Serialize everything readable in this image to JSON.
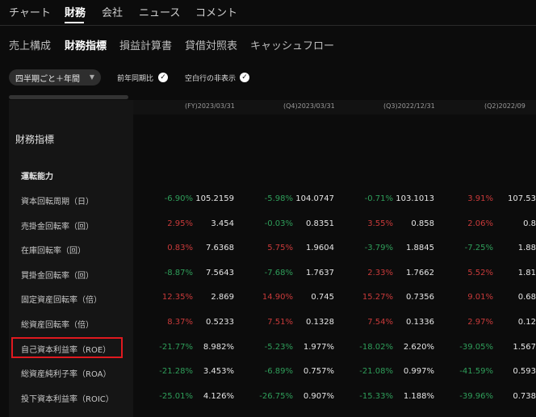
{
  "top_nav": [
    "チャート",
    "財務",
    "会社",
    "ニュース",
    "コメント"
  ],
  "sub_nav": [
    "売上構成",
    "財務指標",
    "損益計算書",
    "貸借対照表",
    "キャッシュフロー"
  ],
  "controls": {
    "period_select": "四半期ごと＋年間",
    "toggle_yoy": "前年同期比",
    "toggle_hide_empty": "空白行の非表示"
  },
  "columns": [
    "(FY)2023/03/31",
    "(Q4)2023/03/31",
    "(Q3)2022/12/31",
    "(Q2)2022/09"
  ],
  "section_title": "財務指標",
  "group_title": "運転能力",
  "rows": [
    {
      "label": "資本回転周期（日）",
      "cells": [
        {
          "pct": "-6.90%",
          "val": "105.2159"
        },
        {
          "pct": "-5.98%",
          "val": "104.0747"
        },
        {
          "pct": "-0.71%",
          "val": "103.1013"
        },
        {
          "pct": "3.91%",
          "val": "107.53"
        }
      ]
    },
    {
      "label": "売掛金回転率（回）",
      "cells": [
        {
          "pct": "2.95%",
          "val": "3.454"
        },
        {
          "pct": "-0.03%",
          "val": "0.8351"
        },
        {
          "pct": "3.55%",
          "val": "0.858"
        },
        {
          "pct": "2.06%",
          "val": "0.8"
        }
      ]
    },
    {
      "label": "在庫回転率（回）",
      "cells": [
        {
          "pct": "0.83%",
          "val": "7.6368"
        },
        {
          "pct": "5.75%",
          "val": "1.9604"
        },
        {
          "pct": "-3.79%",
          "val": "1.8845"
        },
        {
          "pct": "-7.25%",
          "val": "1.88"
        }
      ]
    },
    {
      "label": "買掛金回転率（回）",
      "cells": [
        {
          "pct": "-8.87%",
          "val": "7.5643"
        },
        {
          "pct": "-7.68%",
          "val": "1.7637"
        },
        {
          "pct": "2.33%",
          "val": "1.7662"
        },
        {
          "pct": "5.52%",
          "val": "1.81"
        }
      ]
    },
    {
      "label": "固定資産回転率（倍）",
      "cells": [
        {
          "pct": "12.35%",
          "val": "2.869"
        },
        {
          "pct": "14.90%",
          "val": "0.745"
        },
        {
          "pct": "15.27%",
          "val": "0.7356"
        },
        {
          "pct": "9.01%",
          "val": "0.68"
        }
      ]
    },
    {
      "label": "総資産回転率（倍）",
      "cells": [
        {
          "pct": "8.37%",
          "val": "0.5233"
        },
        {
          "pct": "7.51%",
          "val": "0.1328"
        },
        {
          "pct": "7.54%",
          "val": "0.1336"
        },
        {
          "pct": "2.97%",
          "val": "0.12"
        }
      ]
    },
    {
      "label": "自己資本利益率（ROE）",
      "cells": [
        {
          "pct": "-21.77%",
          "val": "8.982%"
        },
        {
          "pct": "-5.23%",
          "val": "1.977%"
        },
        {
          "pct": "-18.02%",
          "val": "2.620%"
        },
        {
          "pct": "-39.05%",
          "val": "1.567"
        }
      ]
    },
    {
      "label": "総資産純利子率（ROA）",
      "cells": [
        {
          "pct": "-21.28%",
          "val": "3.453%"
        },
        {
          "pct": "-6.89%",
          "val": "0.757%"
        },
        {
          "pct": "-21.08%",
          "val": "0.997%"
        },
        {
          "pct": "-41.59%",
          "val": "0.593"
        }
      ]
    },
    {
      "label": "投下資本利益率（ROIC）",
      "cells": [
        {
          "pct": "-25.01%",
          "val": "4.126%"
        },
        {
          "pct": "-26.75%",
          "val": "0.907%"
        },
        {
          "pct": "-15.33%",
          "val": "1.188%"
        },
        {
          "pct": "-39.96%",
          "val": "0.738"
        }
      ]
    }
  ],
  "colors": {
    "positive": "#2f9e5a",
    "negative": "#c93a3a",
    "highlight": "#e0191f"
  }
}
